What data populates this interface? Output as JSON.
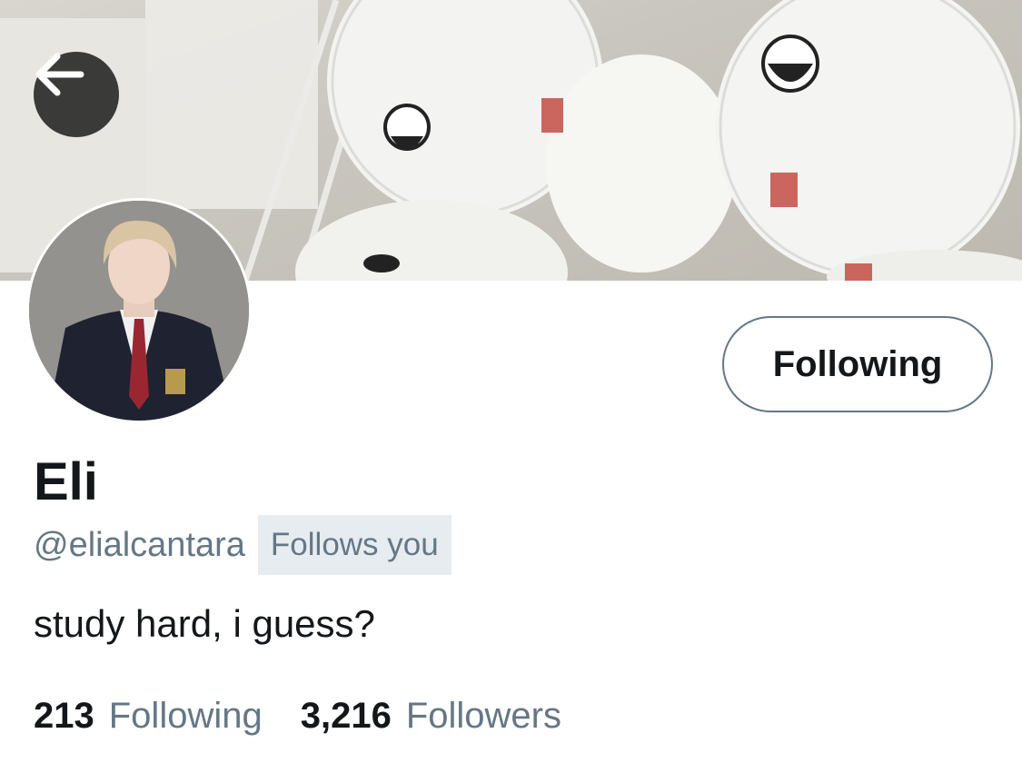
{
  "profile": {
    "display_name": "Eli",
    "handle": "@elialcantara",
    "follows_you_badge": "Follows you",
    "bio": "study hard, i guess?",
    "follow_button_label": "Following"
  },
  "stats": {
    "following_count": "213",
    "following_label": "Following",
    "followers_count": "3,216",
    "followers_label": "Followers"
  },
  "icons": {
    "back": "arrow-left-icon"
  },
  "colors": {
    "secondary_text": "#657786",
    "badge_background": "#e6ecf0",
    "primary_text": "#14171a"
  }
}
